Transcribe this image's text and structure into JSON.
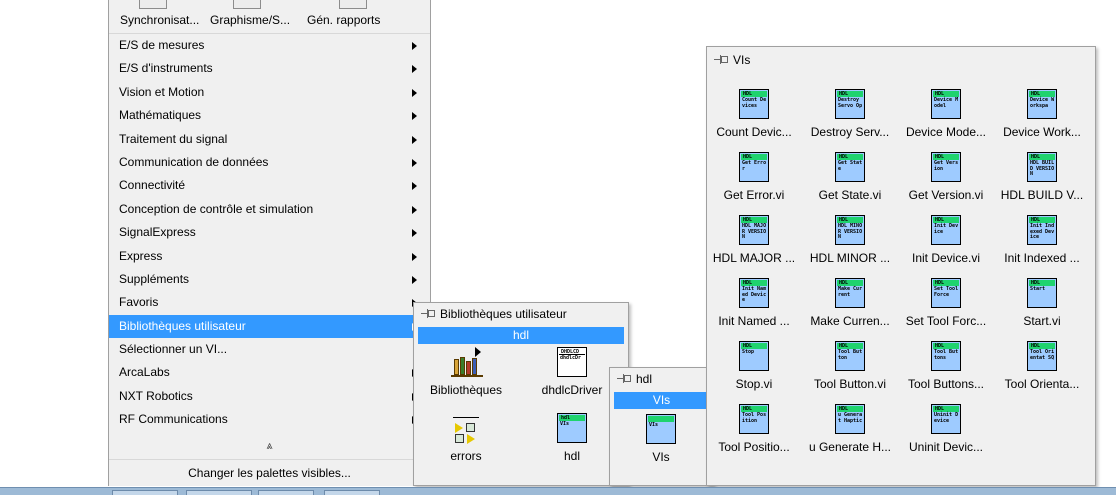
{
  "palette": {
    "top_categories": [
      {
        "label": "Synchronisat...",
        "icon": "synchronisation-icon"
      },
      {
        "label": "Graphisme/S...",
        "icon": "graphisme-icon"
      },
      {
        "label": "Gén. rapports",
        "icon": "rapports-icon"
      }
    ],
    "items": [
      {
        "label": "E/S de mesures",
        "submenu": true
      },
      {
        "label": "E/S d'instruments",
        "submenu": true
      },
      {
        "label": "Vision et Motion",
        "submenu": true
      },
      {
        "label": "Mathématiques",
        "submenu": true
      },
      {
        "label": "Traitement du signal",
        "submenu": true
      },
      {
        "label": "Communication de données",
        "submenu": true
      },
      {
        "label": "Connectivité",
        "submenu": true
      },
      {
        "label": "Conception de contrôle et simulation",
        "submenu": true
      },
      {
        "label": "SignalExpress",
        "submenu": true
      },
      {
        "label": "Express",
        "submenu": true
      },
      {
        "label": "Suppléments",
        "submenu": true
      },
      {
        "label": "Favoris",
        "submenu": true
      },
      {
        "label": "Bibliothèques utilisateur",
        "submenu": true,
        "selected": true
      },
      {
        "label": "Sélectionner un VI...",
        "submenu": false
      },
      {
        "label": "ArcaLabs",
        "submenu": true
      },
      {
        "label": "NXT Robotics",
        "submenu": true
      },
      {
        "label": "RF Communications",
        "submenu": true
      }
    ],
    "expander": "⩓",
    "change_button": "Changer les palettes visibles..."
  },
  "user_libraries": {
    "title": "Bibliothèques utilisateur",
    "selected": "hdl",
    "tiles": [
      {
        "label": "Bibliothèques",
        "icon": "libraries-icon"
      },
      {
        "label": "dhdlcDriver",
        "icon": "dhdlcdriver-icon",
        "icon_text": [
          "DHDLCD",
          "dhdlcDr"
        ]
      },
      {
        "label": "errors",
        "icon": "errors-icon"
      },
      {
        "label": "hdl",
        "icon": "hdl-folder-icon",
        "icon_text": [
          "hdl",
          "VIs"
        ]
      }
    ]
  },
  "hdl_palette": {
    "title": "hdl",
    "selected": "VIs",
    "tiles": [
      {
        "label": "VIs",
        "icon": "vis-folder-icon",
        "icon_text": [
          "",
          "VIs"
        ]
      }
    ]
  },
  "vis_palette": {
    "title": "VIs",
    "vis": [
      {
        "label": "Count Devic...",
        "icon_text": "Count Devices"
      },
      {
        "label": "Destroy Serv...",
        "icon_text": "Destroy Servo Op"
      },
      {
        "label": "Device Mode...",
        "icon_text": "Device Model"
      },
      {
        "label": "Device Work...",
        "icon_text": "Device Workspa"
      },
      {
        "label": "Get Error.vi",
        "icon_text": "Get Error"
      },
      {
        "label": "Get State.vi",
        "icon_text": "Get State"
      },
      {
        "label": "Get Version.vi",
        "icon_text": "Get Version"
      },
      {
        "label": "HDL BUILD V...",
        "icon_text": "HDL BUILD VERSION"
      },
      {
        "label": "HDL MAJOR ...",
        "icon_text": "HDL MAJOR VERSION"
      },
      {
        "label": "HDL MINOR ...",
        "icon_text": "HDL MINOR VERSION"
      },
      {
        "label": "Init Device.vi",
        "icon_text": "Init Device"
      },
      {
        "label": "Init Indexed ...",
        "icon_text": "Init Indexed Device"
      },
      {
        "label": "Init Named ...",
        "icon_text": "Init Named Device"
      },
      {
        "label": "Make Curren...",
        "icon_text": "Make Current"
      },
      {
        "label": "Set Tool Forc...",
        "icon_text": "Set Tool Force"
      },
      {
        "label": "Start.vi",
        "icon_text": "Start"
      },
      {
        "label": "Stop.vi",
        "icon_text": "Stop"
      },
      {
        "label": "Tool Button.vi",
        "icon_text": "Tool Button"
      },
      {
        "label": "Tool Buttons...",
        "icon_text": "Tool Buttons"
      },
      {
        "label": "Tool Orienta...",
        "icon_text": "Tool Orientat SQ"
      },
      {
        "label": "Tool Positio...",
        "icon_text": "Tool Position"
      },
      {
        "label": "u Generate H...",
        "icon_text": "u Generat Haptic"
      },
      {
        "label": "Uninit Devic...",
        "icon_text": "Uninit Device"
      }
    ],
    "hdl_badge": "HDL"
  }
}
